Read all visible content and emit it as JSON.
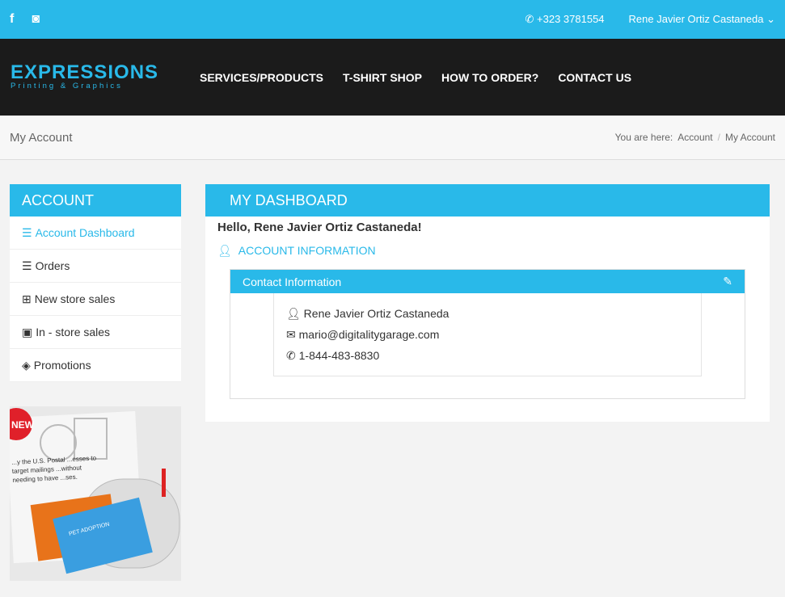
{
  "topbar": {
    "facebook": "f",
    "instagram": "◙",
    "phone": "+323 3781554",
    "user": "Rene Javier Ortiz Castaneda"
  },
  "logo": {
    "line1": "EXPRESSIONS",
    "line2": "Printing & Graphics"
  },
  "menu": [
    "SERVICES/PRODUCTS",
    "T-SHIRT SHOP",
    "HOW TO ORDER?",
    "CONTACT US"
  ],
  "page_title": "My Account",
  "breadcrumb": {
    "prefix": "You are here:",
    "items": [
      "Account",
      "My Account"
    ]
  },
  "sidebar": {
    "title": "ACCOUNT",
    "items": [
      {
        "icon": "☰",
        "label": "Account Dashboard"
      },
      {
        "icon": "☰",
        "label": "Orders"
      },
      {
        "icon": "⊞",
        "label": "New store sales"
      },
      {
        "icon": "▣",
        "label": "In - store sales"
      },
      {
        "icon": "◈",
        "label": "Promotions"
      }
    ]
  },
  "promo": {
    "badge": "NEW",
    "text": "...y the U.S. Postal ...esses to target mailings ...without needing to have ...ses.",
    "card": "PET ADOPTION"
  },
  "main": {
    "title": "MY DASHBOARD",
    "greeting": "Hello, Rene Javier Ortiz Castaneda!",
    "account_info": "ACCOUNT INFORMATION",
    "contact_title": "Contact Information",
    "name": "Rene Javier Ortiz Castaneda",
    "email": "mario@digitalitygarage.com",
    "phone": "1-844-483-8830"
  }
}
